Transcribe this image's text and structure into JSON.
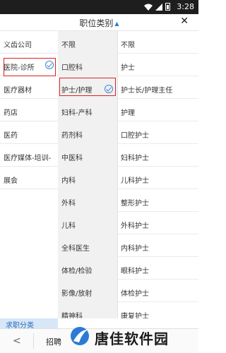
{
  "status_bar": {
    "time": "3:28"
  },
  "header": {
    "title": "职位类别",
    "close_glyph": "✕"
  },
  "columns": {
    "level1": [
      "义齿公司",
      "医院-诊所",
      "医疗器材",
      "药店",
      "医药",
      "医疗媒体-培训-",
      "展会"
    ],
    "level2": [
      "不限",
      "口腔科",
      "护士/护理",
      "妇科-产科",
      "药剂科",
      "中医科",
      "内科",
      "外科",
      "儿科",
      "全科医生",
      "体检/检验",
      "影像/放射",
      "精神科"
    ],
    "level3": [
      "不限",
      "护士",
      "护士长/护理主任",
      "护理",
      "口腔护士",
      "妇科护士",
      "儿科护士",
      "整形护士",
      "外科护士",
      "内科护士",
      "眼科护士",
      "体检护士",
      "康复护士"
    ]
  },
  "selected": {
    "level1": "医院-诊所",
    "level2": "护士/护理"
  },
  "bottom": {
    "tab_label": "求职分类",
    "back_glyph": "<",
    "partial_label": "招聘"
  },
  "watermark": {
    "text": "唐佳软件园"
  },
  "colors": {
    "accent": "#3a86d8",
    "highlight_border": "#e02020",
    "tab_bg": "#d7e7f8"
  },
  "icons": [
    "wifi-icon",
    "signal-icon",
    "battery-icon",
    "caret-up-icon",
    "close-icon",
    "check-circle-icon",
    "back-arrow-icon"
  ]
}
